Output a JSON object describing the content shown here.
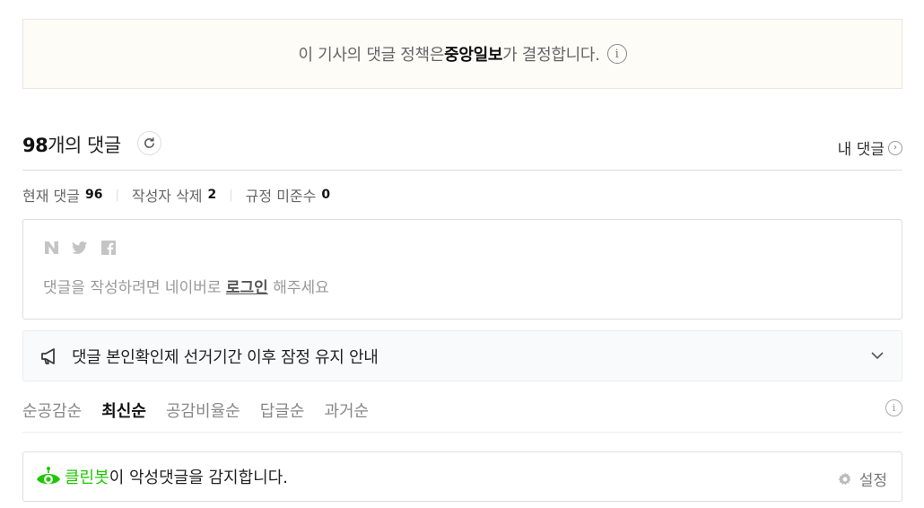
{
  "policy": {
    "prefix": "이 기사의 댓글 정책은 ",
    "publisher": "중앙일보",
    "suffix": "가 결정합니다."
  },
  "comments_header": {
    "count": "98",
    "count_label": "개의 댓글",
    "my_comments_label": "내 댓글"
  },
  "stats": {
    "current_label": "현재 댓글",
    "current_value": "96",
    "deleted_label": "작성자 삭제",
    "deleted_value": "2",
    "violation_label": "규정 미준수",
    "violation_value": "0"
  },
  "login": {
    "prefix": "댓글을 작성하려면 네이버로 ",
    "link": "로그인",
    "suffix": " 해주세요"
  },
  "notice": {
    "text": "댓글 본인확인제 선거기간 이후 잠정 유지 안내"
  },
  "sort_tabs": [
    {
      "label": "순공감순",
      "active": false
    },
    {
      "label": "최신순",
      "active": true
    },
    {
      "label": "공감비율순",
      "active": false
    },
    {
      "label": "답글순",
      "active": false
    },
    {
      "label": "과거순",
      "active": false
    }
  ],
  "cleanbot": {
    "name": "클린봇",
    "text": "이 악성댓글을 감지합니다.",
    "settings_label": "설정",
    "accent": "#1ec800"
  }
}
